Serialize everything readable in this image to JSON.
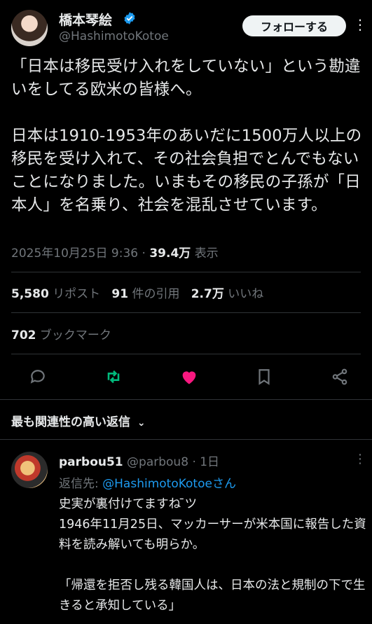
{
  "post": {
    "author_name": "橋本琴絵",
    "author_handle": "@HashimotoKotoe",
    "follow_label": "フォローする",
    "text": "「日本は移民受け入れをしていない」という勘違いをしてる欧米の皆様へ。\n\n日本は1910-1953年のあいだに1500万人以上の移民を受け入れて、その社会負担でとんでもないことになりました。いまもその移民の子孫が「日本人」を名乗り、社会を混乱させています。",
    "timestamp": "2025年10月25日 9:36",
    "views_count": "39.4万",
    "views_label": "表示"
  },
  "stats": {
    "reposts_count": "5,580",
    "reposts_label": "リポスト",
    "quotes_count": "91",
    "quotes_label": "件の引用",
    "likes_count": "2.7万",
    "likes_label": "いいね",
    "bookmarks_count": "702",
    "bookmarks_label": "ブックマーク"
  },
  "actions": [
    {
      "name": "reply-icon",
      "color": "#71767b"
    },
    {
      "name": "repost-icon",
      "color": "#00ba7c"
    },
    {
      "name": "like-icon",
      "color": "#f91880"
    },
    {
      "name": "bookmark-icon",
      "color": "#71767b"
    },
    {
      "name": "share-icon",
      "color": "#71767b"
    }
  ],
  "replies_sort_label": "最も関連性の高い返信",
  "reply": {
    "name": "parbou51",
    "handle": "@parbou8",
    "age": "· 1日",
    "reply_prefix": "返信先:",
    "reply_target": "@HashimotoKotoeさん",
    "text": "史実が裏付けてますね ̄ツ\n1946年11月25日、マッカーサーが米本国に報告した資料を読み解いても明らか。\n\n「帰還を拒否し残る韓国人は、日本の法と規制の下で生きると承知している」"
  },
  "colors": {
    "background": "#000000",
    "text": "#e7e9ea",
    "muted": "#71767b",
    "link": "#1d9bf0",
    "divider": "#2f3336"
  }
}
